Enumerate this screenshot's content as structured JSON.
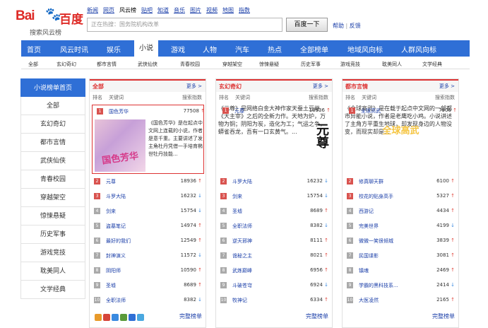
{
  "logo": {
    "bai": "Bai",
    "du": "百度",
    "sub": "搜索风云榜"
  },
  "topnav": [
    "新闻",
    "网页",
    "风云榜",
    "贴吧",
    "知道",
    "音乐",
    "图片",
    "视频",
    "地图",
    "指数"
  ],
  "search": {
    "placeholder": "正在热搜：国务院机构改革",
    "button": "百度一下",
    "help": "帮助",
    "feedback": "反馈"
  },
  "mainnav": [
    "首页",
    "风云时讯",
    "娱乐",
    "小说",
    "游戏",
    "人物",
    "汽车",
    "热点",
    "全部榜单",
    "地域风向标",
    "人群风向标"
  ],
  "subnav": [
    "全部",
    "玄幻奇幻",
    "都市言情",
    "武侠仙侠",
    "青春校园",
    "穿越架空",
    "惊悚悬疑",
    "历史军事",
    "游戏竞技",
    "耽美同人",
    "文学经典"
  ],
  "side": [
    "小说榜单首页",
    "全部",
    "玄幻奇幻",
    "都市言情",
    "武侠仙侠",
    "青春校园",
    "穿越架空",
    "惊悚悬疑",
    "历史军事",
    "游戏竞技",
    "耽美同人",
    "文学经典"
  ],
  "colhdr": {
    "rank": "排名",
    "kw": "关键词",
    "idx": "搜索指数",
    "more": "更多 >",
    "full": "完整榜单"
  },
  "cols": [
    {
      "title": "全部",
      "top": {
        "name": "国色芳华",
        "val": "77508",
        "desc": "《国色芳华》是在起点中文网上连载的小说，作者是意千重。主要讲述了发主角杜丹凭借一手培育椭世牡丹技能...",
        "cover": "国色芳华"
      },
      "rows": [
        [
          "元尊",
          "18936",
          "up"
        ],
        [
          "斗罗大陆",
          "16232",
          "dn"
        ],
        [
          "剑来",
          "15754",
          "dn"
        ],
        [
          "盗墓笔记",
          "14974",
          "up"
        ],
        [
          "最好的我们",
          "12549",
          "up"
        ],
        [
          "封神演义",
          "11572",
          "dn"
        ],
        [
          "阴阳师",
          "10590",
          "up"
        ],
        [
          "圣墟",
          "8689",
          "up"
        ],
        [
          "全职法师",
          "8382",
          "dn"
        ]
      ]
    },
    {
      "title": "玄幻奇幻",
      "top": {
        "name": "元尊",
        "val": "18936",
        "desc": "《元尊》是网络白金大神作家天蚕土豆继《大主宰》之后的全新力作。天地为炉，万物为铜；阴阳为炭，造化为工；气运之争，蟒雀吞龙，吾有一口玄黄气。...",
        "cover": "元尊"
      },
      "rows": [
        [
          "斗罗大陆",
          "16232",
          "dn"
        ],
        [
          "剑来",
          "15754",
          "dn"
        ],
        [
          "圣墟",
          "8689",
          "up"
        ],
        [
          "全职法师",
          "8382",
          "dn"
        ],
        [
          "逆天邪神",
          "8111",
          "up"
        ],
        [
          "诡秘之主",
          "8021",
          "up"
        ],
        [
          "武炼巅峰",
          "6956",
          "up"
        ],
        [
          "斗破苍穹",
          "6924",
          "dn"
        ],
        [
          "牧神记",
          "6334",
          "up"
        ]
      ]
    },
    {
      "title": "都市言情",
      "top": {
        "name": "全球高武",
        "val": "7906",
        "desc": "《全球高武》是在载于起点中文网的一部都市异能小说，作者是老鹰吃小鸡。小说讲述了主角方平重生地球，却发现身边的人物没变，而现实却是...",
        "cover": "全球高武"
      },
      "rows": [
        [
          "修真聊天群",
          "6100",
          "up"
        ],
        [
          "校花的贴身高手",
          "5327",
          "up"
        ],
        [
          "西游记",
          "4434",
          "up"
        ],
        [
          "完美世界",
          "4199",
          "dn"
        ],
        [
          "微微一笑很倾城",
          "3839",
          "up"
        ],
        [
          "民国谍影",
          "3081",
          "up"
        ],
        [
          "镇魂",
          "2469",
          "up"
        ],
        [
          "学霸的黑科技系...",
          "2414",
          "dn"
        ],
        [
          "大医凌然",
          "2165",
          "up"
        ]
      ]
    }
  ],
  "colors": {
    "accent": "#2f6fd6",
    "red": "#d33"
  }
}
